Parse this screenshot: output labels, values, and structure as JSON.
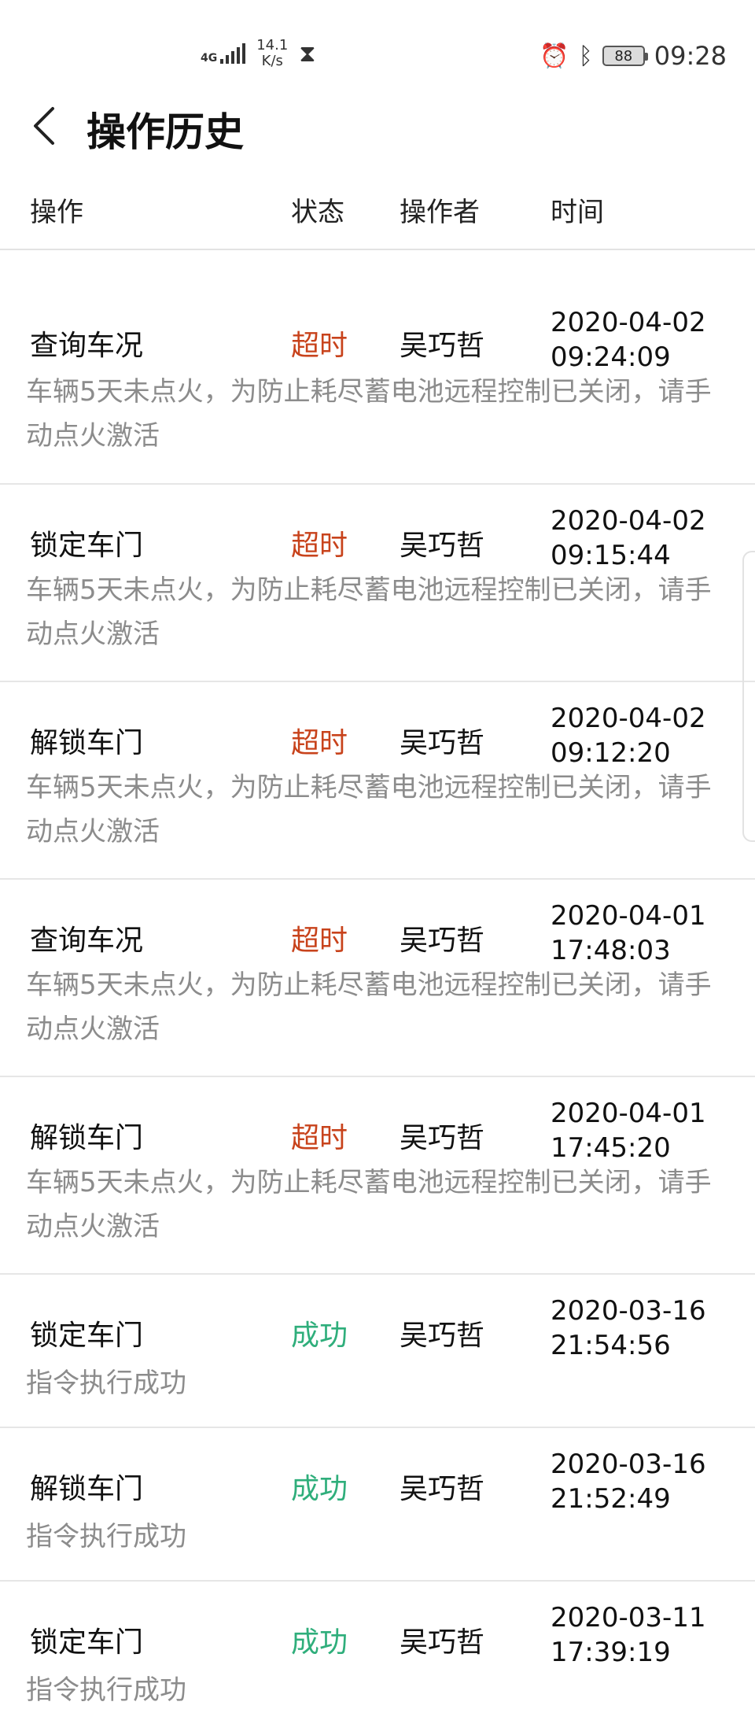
{
  "status_bar": {
    "network_type": "4G",
    "speed_value": "14.1",
    "speed_unit": "K/s",
    "battery": "88",
    "time": "09:28",
    "icons": [
      "signal-icon",
      "hourglass-icon",
      "alarm-icon",
      "bluetooth-icon",
      "battery-icon"
    ]
  },
  "header": {
    "title": "操作历史",
    "back_icon": "chevron-left-icon"
  },
  "columns": {
    "operation": "操作",
    "status": "状态",
    "operator": "操作者",
    "time": "时间"
  },
  "records": [
    {
      "operation": "查询车况",
      "status": "超时",
      "status_type": "fail",
      "operator": "吴巧哲",
      "date": "2020-04-02",
      "time": "09:24:09",
      "desc": "车辆5天未点火，为防止耗尽蓄电池远程控制已关闭，请手动点火激活"
    },
    {
      "operation": "锁定车门",
      "status": "超时",
      "status_type": "fail",
      "operator": "吴巧哲",
      "date": "2020-04-02",
      "time": "09:15:44",
      "desc": "车辆5天未点火，为防止耗尽蓄电池远程控制已关闭，请手动点火激活"
    },
    {
      "operation": "解锁车门",
      "status": "超时",
      "status_type": "fail",
      "operator": "吴巧哲",
      "date": "2020-04-02",
      "time": "09:12:20",
      "desc": "车辆5天未点火，为防止耗尽蓄电池远程控制已关闭，请手动点火激活"
    },
    {
      "operation": "查询车况",
      "status": "超时",
      "status_type": "fail",
      "operator": "吴巧哲",
      "date": "2020-04-01",
      "time": "17:48:03",
      "desc": "车辆5天未点火，为防止耗尽蓄电池远程控制已关闭，请手动点火激活"
    },
    {
      "operation": "解锁车门",
      "status": "超时",
      "status_type": "fail",
      "operator": "吴巧哲",
      "date": "2020-04-01",
      "time": "17:45:20",
      "desc": "车辆5天未点火，为防止耗尽蓄电池远程控制已关闭，请手动点火激活"
    },
    {
      "operation": "锁定车门",
      "status": "成功",
      "status_type": "ok",
      "operator": "吴巧哲",
      "date": "2020-03-16",
      "time": "21:54:56",
      "desc": "指令执行成功"
    },
    {
      "operation": "解锁车门",
      "status": "成功",
      "status_type": "ok",
      "operator": "吴巧哲",
      "date": "2020-03-16",
      "time": "21:52:49",
      "desc": "指令执行成功"
    },
    {
      "operation": "锁定车门",
      "status": "成功",
      "status_type": "ok",
      "operator": "吴巧哲",
      "date": "2020-03-11",
      "time": "17:39:19",
      "desc": "指令执行成功"
    }
  ],
  "colors": {
    "fail": "#c8431c",
    "ok": "#2fae7b",
    "desc": "#8c8c8c"
  }
}
